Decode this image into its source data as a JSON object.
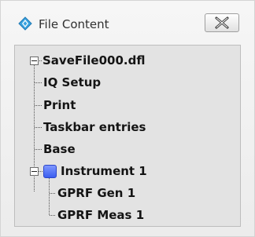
{
  "window": {
    "title": "File Content",
    "icon": "diamond-arrows-icon",
    "close_icon": "close-x-icon"
  },
  "tree": {
    "root": {
      "label": "SaveFile000.dfl",
      "expanded": true,
      "children": [
        {
          "label": "IQ Setup"
        },
        {
          "label": "Print"
        },
        {
          "label": "Taskbar entries"
        },
        {
          "label": "Base"
        },
        {
          "label": "Instrument 1",
          "expanded": true,
          "icon": "instrument-icon",
          "icon_color": "#3b5ef0",
          "children": [
            {
              "label": "GPRF Gen 1"
            },
            {
              "label": "GPRF Meas 1"
            }
          ]
        }
      ]
    }
  }
}
